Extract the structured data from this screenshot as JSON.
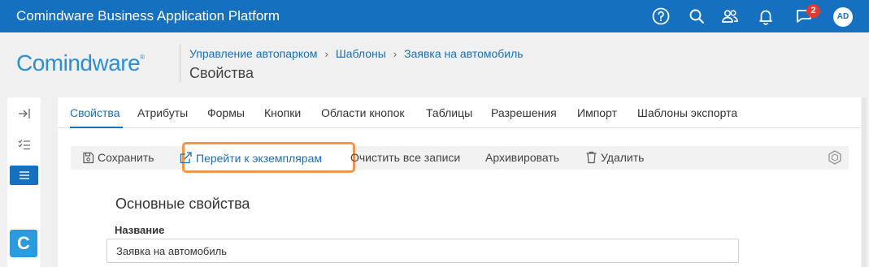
{
  "topbar": {
    "app_title": "Comindware Business Application Platform",
    "icons": [
      "help-icon",
      "search-icon",
      "users-icon",
      "bell-icon",
      "chat-icon"
    ],
    "notification_count": "2",
    "avatar_initials": "AD",
    "bg_color": "#1570c0"
  },
  "header": {
    "logo_text": "Comindware",
    "logo_mark": "®",
    "breadcrumb": [
      "Управление автопарком",
      "Шаблоны",
      "Заявка на автомобиль"
    ],
    "page_title": "Свойства"
  },
  "rail": {
    "icons": [
      "expand-icon",
      "checklist-icon",
      "menu-icon"
    ],
    "app_letter": "C"
  },
  "tabs": [
    "Свойства",
    "Атрибуты",
    "Формы",
    "Кнопки",
    "Области кнопок",
    "Таблицы",
    "Разрешения",
    "Импорт",
    "Шаблоны экспорта"
  ],
  "active_tab": "Свойства",
  "toolbar": {
    "save": "Сохранить",
    "go_to_instances": "Перейти к экземплярам",
    "clear_all": "Очистить все записи",
    "archive": "Архивировать",
    "delete": "Удалить"
  },
  "form": {
    "section_title": "Основные свойства",
    "name_label": "Название",
    "name_value": "Заявка на автомобиль"
  },
  "colors": {
    "accent": "#1570c0",
    "highlight": "#f0964a",
    "badge": "#e23b2e"
  }
}
